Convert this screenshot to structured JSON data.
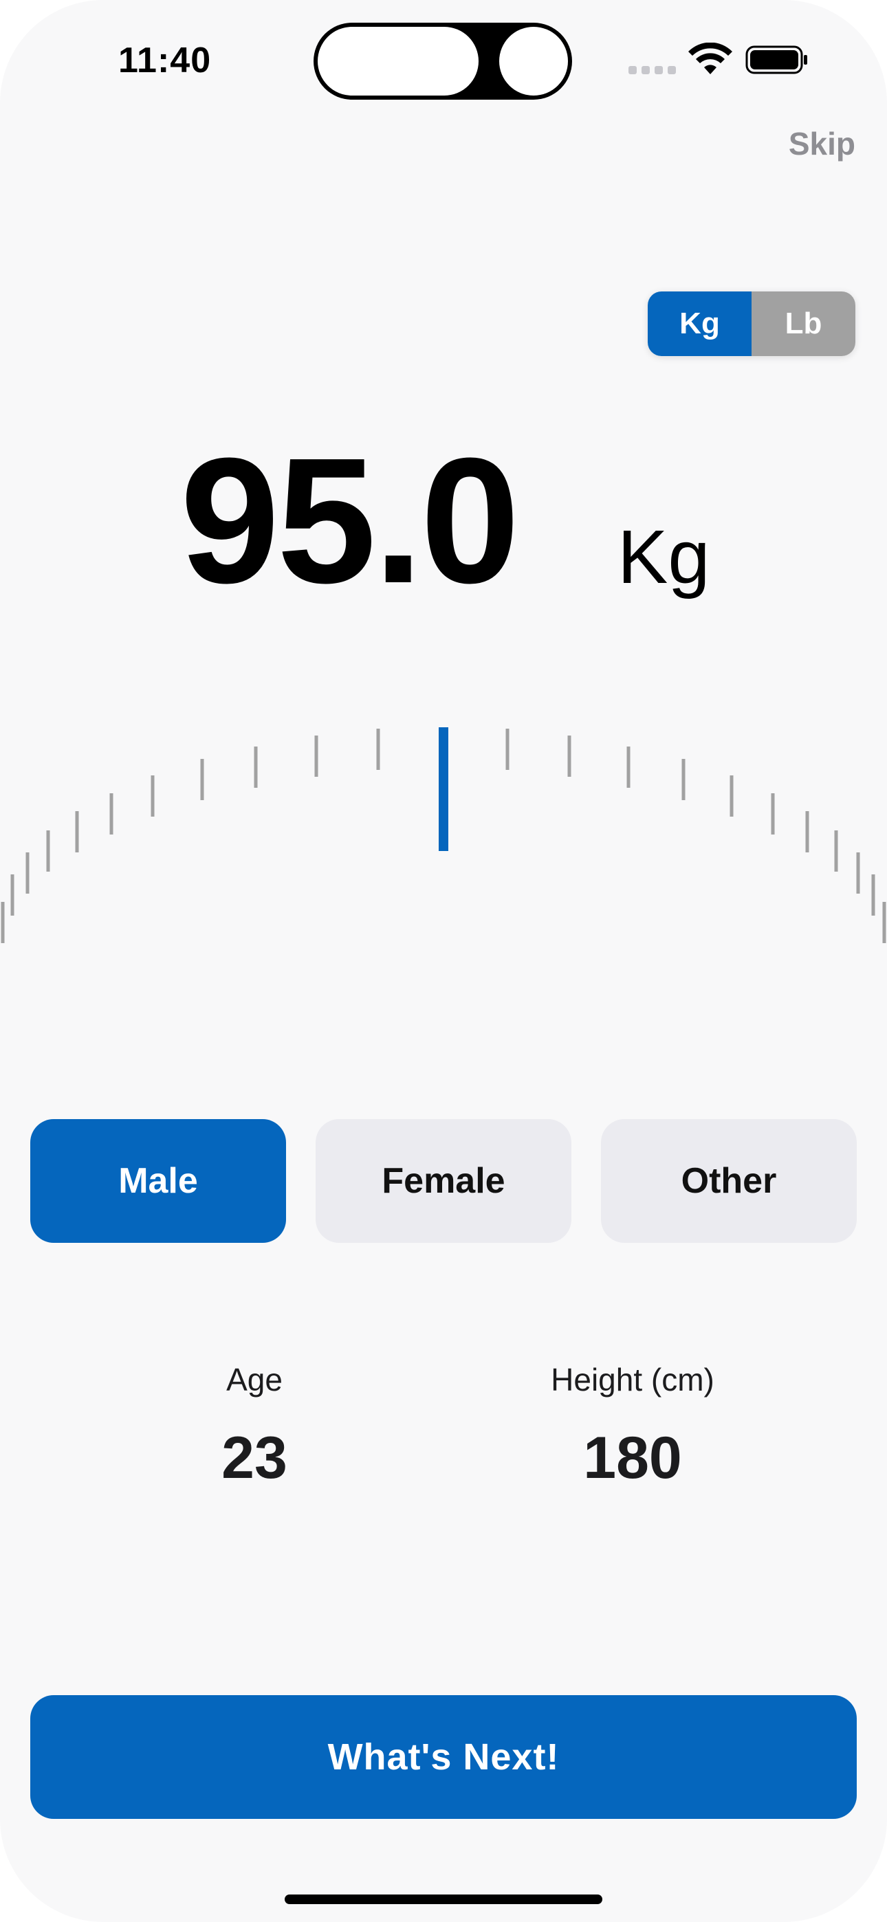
{
  "status_bar": {
    "time": "11:40"
  },
  "header": {
    "skip_label": "Skip"
  },
  "unit_toggle": {
    "options": [
      "Kg",
      "Lb"
    ],
    "selected": "Kg"
  },
  "weight": {
    "value": "95.0",
    "unit": "Kg"
  },
  "dial": {
    "selected_value": 95.0,
    "accent_color": "#0566bd",
    "tick_color": "#a1a1a1"
  },
  "gender": {
    "options": [
      "Male",
      "Female",
      "Other"
    ],
    "selected": "Male"
  },
  "stats": {
    "age_label": "Age",
    "age_value": "23",
    "height_label": "Height (cm)",
    "height_value": "180"
  },
  "footer": {
    "next_label": "What's Next!"
  },
  "colors": {
    "accent": "#0566bd",
    "inactive_toggle": "#a1a1a1",
    "inactive_chip": "#ebebf0",
    "background": "#f8f8f9"
  }
}
